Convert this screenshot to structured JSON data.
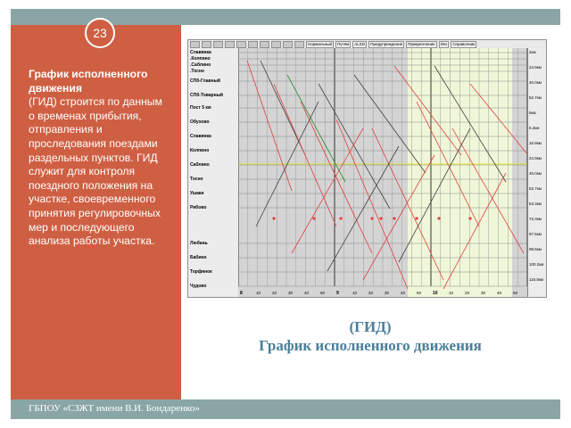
{
  "slide": {
    "number": "23",
    "left_title": "График исполненного движения",
    "left_body_open": "(",
    "left_body": "ГИД) строится по данным о временах прибытия, отправления и проследования  поездами раздельных пунктов. ГИД служит для контроля поездного положения на участке, своевременного принятия регулировочных мер и последующего анализа работы участка.",
    "caption_line1": "(ГИД)",
    "caption_line2": "График исполненного движения",
    "footer": "ГБПОУ «СЗЖТ имени В.И. Бондаренко»"
  },
  "screen": {
    "toolbar_labels": [
      "Нормальный",
      "Путём",
      "ALSO",
      "Предупреждение",
      "Прикрепление",
      "Лес",
      "Справочник"
    ],
    "stations": [
      "Славянка",
      ".Колпино",
      ".Саблино",
      ".Тосно",
      "СПб-Главный",
      "СПб-Товарный",
      "Пост 5 км",
      "Обухово",
      "Славянка",
      "Колпино",
      "Саблино",
      "Тосно",
      "Ушаки",
      "Рябово",
      "Любань",
      "Бабино",
      "Торфяное",
      "Чудово"
    ],
    "scale_labels": [
      "2км",
      "24.9км",
      "40.0км",
      "52.7км",
      "6км",
      "6.2км",
      "16.9км",
      "24.9км",
      "40.0км",
      "52.7км",
      "63.3км",
      "72.3км",
      "87.5км",
      "99.5км",
      "100.2км",
      "116.8км"
    ],
    "hours": [
      "8",
      "9",
      "10",
      "11"
    ],
    "minutes": [
      "10",
      "20",
      "30",
      "40",
      "50"
    ],
    "colors": {
      "grid": "#9a9a9a",
      "train_red": "#e04040",
      "train_dark": "#404040",
      "train_green": "#2a8a2a",
      "highlight": "#f0f7d8"
    }
  }
}
